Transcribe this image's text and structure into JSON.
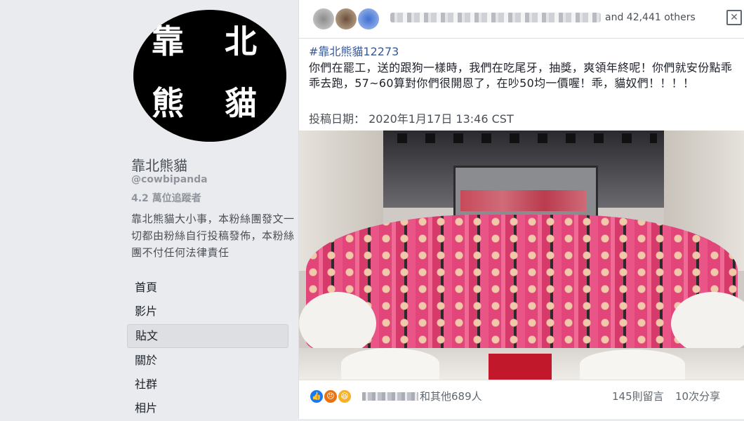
{
  "sidebar": {
    "avatar_chars": [
      "靠",
      "北",
      "熊",
      "貓"
    ],
    "page_name": "靠北熊貓",
    "handle": "@cowbipanda",
    "followers": "4.2 萬位追蹤者",
    "description": "靠北熊貓大小事，本粉絲團發文一切都由粉絲自行投稿發佈，本粉絲團不付任何法律責任",
    "nav": [
      {
        "label": "首頁"
      },
      {
        "label": "影片"
      },
      {
        "label": "貼文"
      },
      {
        "label": "關於"
      },
      {
        "label": "社群"
      },
      {
        "label": "相片"
      }
    ]
  },
  "post": {
    "likers_others": "and 42,441 others",
    "hashtag": "#靠北熊貓12273",
    "text": "你們在罷工，送的跟狗一樣時，我們在吃尾牙，抽獎，爽領年終呢！你們就安份點乖乖去跑，57~60算對你們很開恩了，在吵50均一價喔！乖，貓奴們！！！！",
    "date": "投稿日期： 2020年1月17日 13:46 CST",
    "reactions_others": "和其他689人",
    "comments": "145則留言",
    "shares": "10次分享"
  },
  "colors": {
    "link": "#385898",
    "background": "#e9ebee",
    "shirt_pink": "#e2457a"
  },
  "icons": {
    "close": "close-icon",
    "like": "like-icon",
    "angry": "angry-icon",
    "haha": "haha-icon"
  }
}
